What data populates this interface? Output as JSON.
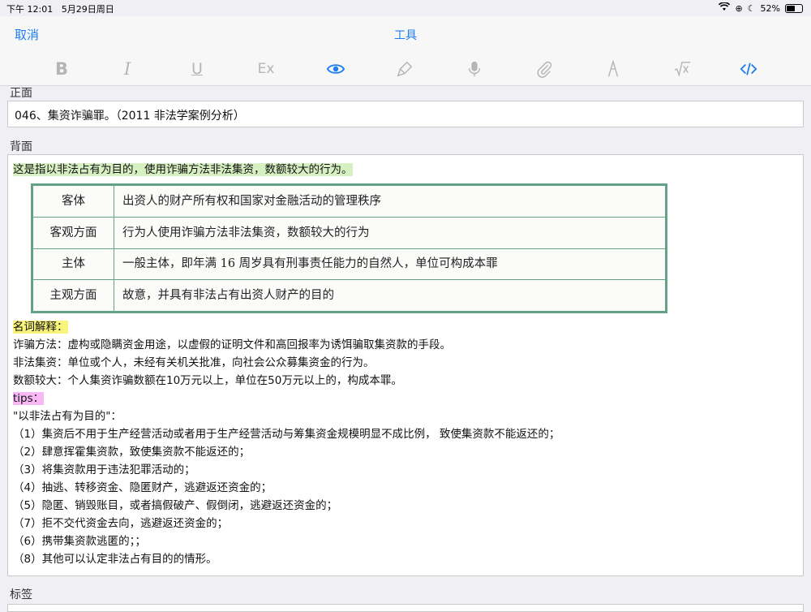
{
  "status": {
    "time": "下午 12:01",
    "date": "5月29日周日",
    "battery": "52%"
  },
  "nav": {
    "cancel": "取消",
    "title": "工具"
  },
  "toolbar": {
    "bold": "B",
    "italic": "I",
    "underline": "U",
    "clear_format": "Ex",
    "icons": [
      "bold-icon",
      "italic-icon",
      "underline-icon",
      "clear-format-icon",
      "eye-icon",
      "brush-icon",
      "mic-icon",
      "paperclip-icon",
      "pen-icon",
      "sqrt-icon",
      "code-icon"
    ],
    "accent": "#1c7ef0"
  },
  "front": {
    "label": "正面",
    "value": "046、集资诈骗罪。（2011 非法学案例分析）"
  },
  "back": {
    "label": "背面",
    "intro": "这是指以非法占有为目的，使用诈骗方法非法集资，数额较大的行为。",
    "table": [
      {
        "key": "客体",
        "value": "出资人的财产所有权和国家对金融活动的管理秩序"
      },
      {
        "key": "客观方面",
        "value": "行为人使用诈骗方法非法集资，数额较大的行为"
      },
      {
        "key": "主体",
        "value": "一般主体，即年满 16 周岁具有刑事责任能力的自然人，单位可构成本罪"
      },
      {
        "key": "主观方面",
        "value": "故意，并具有非法占有出资人财产的目的"
      }
    ],
    "terms_heading": "名词解释：",
    "terms": [
      "诈骗方法：虚构或隐瞒资金用途，以虚假的证明文件和高回报率为诱饵骗取集资款的手段。",
      "非法集资：单位或个人，未经有关机关批准，向社会公众募集资金的行为。",
      "数额较大：个人集资诈骗数额在10万元以上，单位在50万元以上的，构成本罪。"
    ],
    "tips_heading": "tips：",
    "tips_intro": "\"以非法占有为目的\"：",
    "tips": [
      "（1）集资后不用于生产经营活动或者用于生产经营活动与筹集资金规模明显不成比例， 致使集资款不能返还的；",
      "（2）肆意挥霍集资款，致使集资款不能返还的；",
      "（3）将集资款用于违法犯罪活动的；",
      "（4）抽逃、转移资金、隐匿财产，逃避返还资金的；",
      "（5）隐匿、销毁账目，或者搞假破产、假倒闭，逃避返还资金的；",
      "（7）拒不交代资金去向，逃避返还资金的；",
      "（6）携带集资款逃匿的；；",
      "（8）其他可以认定非法占有目的的情形。"
    ]
  },
  "tags": {
    "label": "标签"
  }
}
